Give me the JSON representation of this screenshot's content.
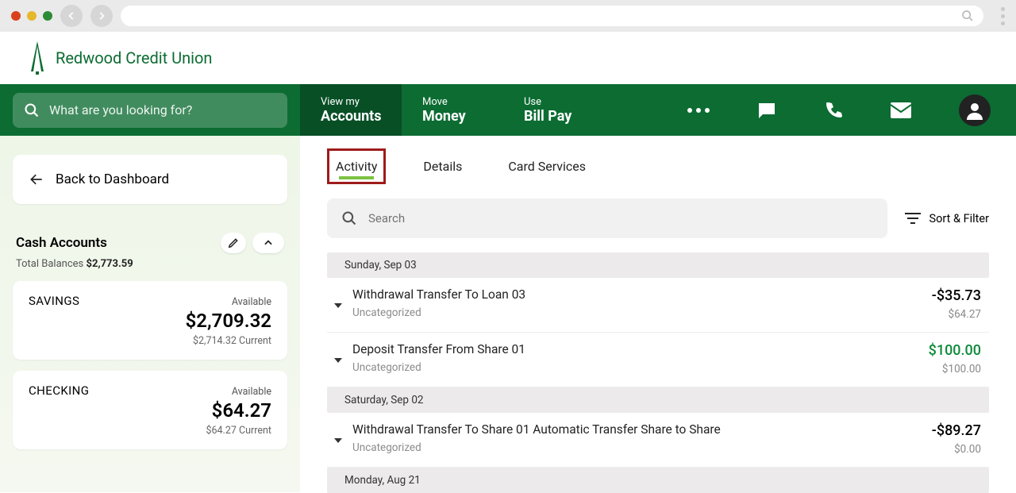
{
  "brand": "Redwood Credit Union",
  "topnav": {
    "search_placeholder": "What are you looking for?",
    "items": [
      {
        "small": "View my",
        "big": "Accounts"
      },
      {
        "small": "Move",
        "big": "Money"
      },
      {
        "small": "Use",
        "big": "Bill Pay"
      }
    ]
  },
  "sidebar": {
    "back_label": "Back to Dashboard",
    "section_title": "Cash Accounts",
    "total_label": "Total Balances",
    "total_value": "$2,773.59",
    "accounts": [
      {
        "name": "SAVINGS",
        "avail_label": "Available",
        "balance": "$2,709.32",
        "current": "$2,714.32 Current"
      },
      {
        "name": "CHECKING",
        "avail_label": "Available",
        "balance": "$64.27",
        "current": "$64.27 Current"
      }
    ]
  },
  "tabs": [
    "Activity",
    "Details",
    "Card Services"
  ],
  "content": {
    "search_placeholder": "Search",
    "sort_label": "Sort & Filter",
    "groups": [
      {
        "date": "Sunday, Sep 03",
        "tx": [
          {
            "desc": "Withdrawal Transfer To Loan 03",
            "cat": "Uncategorized",
            "amt": "-$35.73",
            "bal": "$64.27",
            "pos": false
          },
          {
            "desc": "Deposit Transfer From Share 01",
            "cat": "Uncategorized",
            "amt": "$100.00",
            "bal": "$100.00",
            "pos": true
          }
        ]
      },
      {
        "date": "Saturday, Sep 02",
        "tx": [
          {
            "desc": "Withdrawal Transfer To Share 01 Automatic Transfer Share to Share",
            "cat": "Uncategorized",
            "amt": "-$89.27",
            "bal": "$0.00",
            "pos": false
          }
        ]
      },
      {
        "date": "Monday, Aug 21",
        "tx": []
      }
    ]
  }
}
